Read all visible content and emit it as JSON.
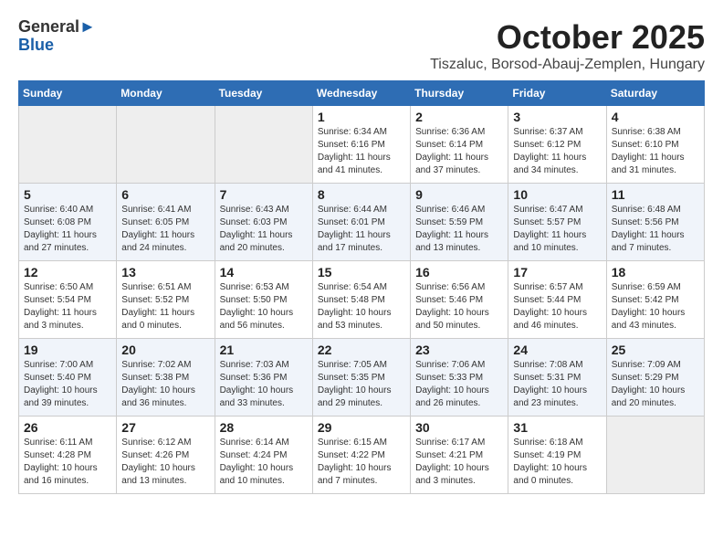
{
  "header": {
    "logo_general": "General",
    "logo_blue": "Blue",
    "month_title": "October 2025",
    "location": "Tiszaluc, Borsod-Abauj-Zemplen, Hungary"
  },
  "weekdays": [
    "Sunday",
    "Monday",
    "Tuesday",
    "Wednesday",
    "Thursday",
    "Friday",
    "Saturday"
  ],
  "weeks": [
    [
      {
        "day": "",
        "info": ""
      },
      {
        "day": "",
        "info": ""
      },
      {
        "day": "",
        "info": ""
      },
      {
        "day": "1",
        "info": "Sunrise: 6:34 AM\nSunset: 6:16 PM\nDaylight: 11 hours\nand 41 minutes."
      },
      {
        "day": "2",
        "info": "Sunrise: 6:36 AM\nSunset: 6:14 PM\nDaylight: 11 hours\nand 37 minutes."
      },
      {
        "day": "3",
        "info": "Sunrise: 6:37 AM\nSunset: 6:12 PM\nDaylight: 11 hours\nand 34 minutes."
      },
      {
        "day": "4",
        "info": "Sunrise: 6:38 AM\nSunset: 6:10 PM\nDaylight: 11 hours\nand 31 minutes."
      }
    ],
    [
      {
        "day": "5",
        "info": "Sunrise: 6:40 AM\nSunset: 6:08 PM\nDaylight: 11 hours\nand 27 minutes."
      },
      {
        "day": "6",
        "info": "Sunrise: 6:41 AM\nSunset: 6:05 PM\nDaylight: 11 hours\nand 24 minutes."
      },
      {
        "day": "7",
        "info": "Sunrise: 6:43 AM\nSunset: 6:03 PM\nDaylight: 11 hours\nand 20 minutes."
      },
      {
        "day": "8",
        "info": "Sunrise: 6:44 AM\nSunset: 6:01 PM\nDaylight: 11 hours\nand 17 minutes."
      },
      {
        "day": "9",
        "info": "Sunrise: 6:46 AM\nSunset: 5:59 PM\nDaylight: 11 hours\nand 13 minutes."
      },
      {
        "day": "10",
        "info": "Sunrise: 6:47 AM\nSunset: 5:57 PM\nDaylight: 11 hours\nand 10 minutes."
      },
      {
        "day": "11",
        "info": "Sunrise: 6:48 AM\nSunset: 5:56 PM\nDaylight: 11 hours\nand 7 minutes."
      }
    ],
    [
      {
        "day": "12",
        "info": "Sunrise: 6:50 AM\nSunset: 5:54 PM\nDaylight: 11 hours\nand 3 minutes."
      },
      {
        "day": "13",
        "info": "Sunrise: 6:51 AM\nSunset: 5:52 PM\nDaylight: 11 hours\nand 0 minutes."
      },
      {
        "day": "14",
        "info": "Sunrise: 6:53 AM\nSunset: 5:50 PM\nDaylight: 10 hours\nand 56 minutes."
      },
      {
        "day": "15",
        "info": "Sunrise: 6:54 AM\nSunset: 5:48 PM\nDaylight: 10 hours\nand 53 minutes."
      },
      {
        "day": "16",
        "info": "Sunrise: 6:56 AM\nSunset: 5:46 PM\nDaylight: 10 hours\nand 50 minutes."
      },
      {
        "day": "17",
        "info": "Sunrise: 6:57 AM\nSunset: 5:44 PM\nDaylight: 10 hours\nand 46 minutes."
      },
      {
        "day": "18",
        "info": "Sunrise: 6:59 AM\nSunset: 5:42 PM\nDaylight: 10 hours\nand 43 minutes."
      }
    ],
    [
      {
        "day": "19",
        "info": "Sunrise: 7:00 AM\nSunset: 5:40 PM\nDaylight: 10 hours\nand 39 minutes."
      },
      {
        "day": "20",
        "info": "Sunrise: 7:02 AM\nSunset: 5:38 PM\nDaylight: 10 hours\nand 36 minutes."
      },
      {
        "day": "21",
        "info": "Sunrise: 7:03 AM\nSunset: 5:36 PM\nDaylight: 10 hours\nand 33 minutes."
      },
      {
        "day": "22",
        "info": "Sunrise: 7:05 AM\nSunset: 5:35 PM\nDaylight: 10 hours\nand 29 minutes."
      },
      {
        "day": "23",
        "info": "Sunrise: 7:06 AM\nSunset: 5:33 PM\nDaylight: 10 hours\nand 26 minutes."
      },
      {
        "day": "24",
        "info": "Sunrise: 7:08 AM\nSunset: 5:31 PM\nDaylight: 10 hours\nand 23 minutes."
      },
      {
        "day": "25",
        "info": "Sunrise: 7:09 AM\nSunset: 5:29 PM\nDaylight: 10 hours\nand 20 minutes."
      }
    ],
    [
      {
        "day": "26",
        "info": "Sunrise: 6:11 AM\nSunset: 4:28 PM\nDaylight: 10 hours\nand 16 minutes."
      },
      {
        "day": "27",
        "info": "Sunrise: 6:12 AM\nSunset: 4:26 PM\nDaylight: 10 hours\nand 13 minutes."
      },
      {
        "day": "28",
        "info": "Sunrise: 6:14 AM\nSunset: 4:24 PM\nDaylight: 10 hours\nand 10 minutes."
      },
      {
        "day": "29",
        "info": "Sunrise: 6:15 AM\nSunset: 4:22 PM\nDaylight: 10 hours\nand 7 minutes."
      },
      {
        "day": "30",
        "info": "Sunrise: 6:17 AM\nSunset: 4:21 PM\nDaylight: 10 hours\nand 3 minutes."
      },
      {
        "day": "31",
        "info": "Sunrise: 6:18 AM\nSunset: 4:19 PM\nDaylight: 10 hours\nand 0 minutes."
      },
      {
        "day": "",
        "info": ""
      }
    ]
  ]
}
